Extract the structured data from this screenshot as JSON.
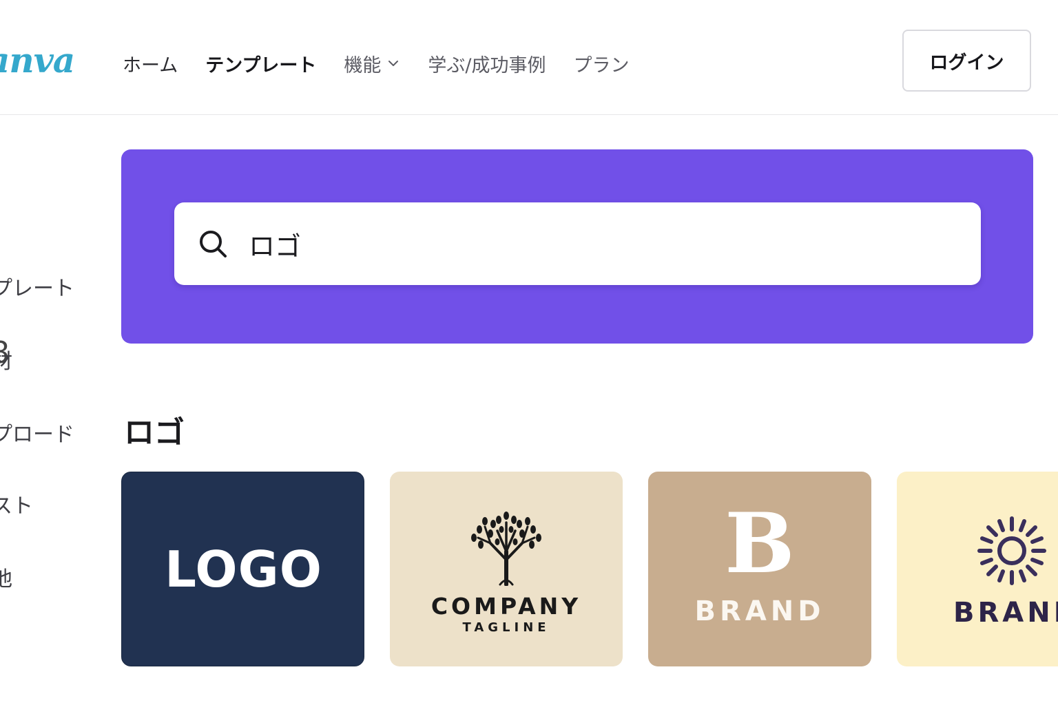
{
  "header": {
    "logo_text": "anva",
    "nav": [
      {
        "label": "ホーム"
      },
      {
        "label": "テンプレート"
      },
      {
        "label": "機能"
      },
      {
        "label": "学ぶ/成功事例"
      },
      {
        "label": "プラン"
      }
    ],
    "login_label": "ログイン"
  },
  "sidebar": {
    "number": "8",
    "items": [
      {
        "label": "プレート"
      },
      {
        "label": "材"
      },
      {
        "label": "プロード"
      },
      {
        "label": "スト"
      },
      {
        "label": "他"
      }
    ]
  },
  "hero": {
    "color": "#7150e8",
    "search": {
      "value": "ロゴ"
    }
  },
  "section": {
    "title": "ロゴ"
  },
  "cards": [
    {
      "text": "LOGO",
      "background": "#213251"
    },
    {
      "title": "COMPANY",
      "tagline": "TAGLINE",
      "icon": "tree-icon",
      "background": "#ede1c9"
    },
    {
      "letter": "B",
      "title": "BRAND",
      "background": "#c8ad8f"
    },
    {
      "title": "BRAND",
      "icon": "sun-icon",
      "background": "#fcf0c7"
    }
  ],
  "colors": {
    "accent": "#7150e8",
    "logo": "#35a8cc"
  }
}
